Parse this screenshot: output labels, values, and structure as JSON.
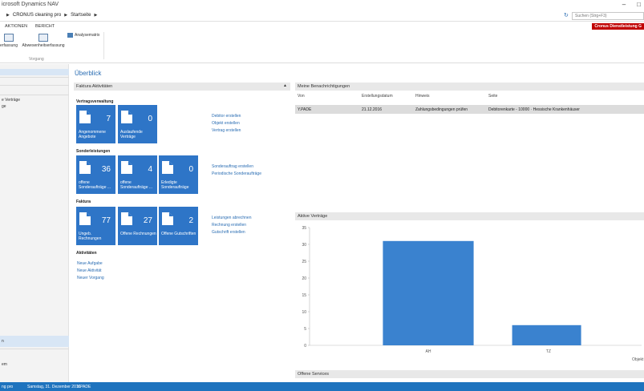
{
  "window": {
    "title": "icrosoft Dynamics NAV"
  },
  "address": {
    "crumbs": [
      "CRONUS cleaning pro",
      "Startseite"
    ],
    "search_placeholder": "Suchen (Strg+F3)"
  },
  "ribbon": {
    "tabs": [
      "AKTIONEN",
      "BERICHT"
    ],
    "company": "Cronus Dienstleistung G",
    "buttons": [
      "erfassung",
      "Abwesenheitserfassung"
    ],
    "analyse": "Analysematrix",
    "group_label": "Vorgang"
  },
  "nav": {
    "items": [
      "e Verträge",
      "ge",
      "n",
      "em"
    ]
  },
  "page": {
    "title": "Überblick"
  },
  "faktura": {
    "header": "Faktura Aktivitäten",
    "sections": {
      "vertrag": "Vertragsverwaltung",
      "sonder": "Sonderleistungen",
      "faktura": "Faktura",
      "aktiv": "Aktivitäten"
    },
    "tiles": {
      "angebote": {
        "value": "7",
        "label": "Angenommene Angebote"
      },
      "vertraege": {
        "value": "0",
        "label": "Auslaufende Verträge"
      },
      "sonder_offen": {
        "value": "36",
        "label": "offene Sonderaufträge ..."
      },
      "sonder_offen2": {
        "value": "4",
        "label": "offene Sonderaufträge ..."
      },
      "sonder_erl": {
        "value": "0",
        "label": "Erledigte Sonderaufträge"
      },
      "ungeb": {
        "value": "77",
        "label": "Ungeb. Rechnungen"
      },
      "rechnungen": {
        "value": "27",
        "label": "Offene Rechnungen"
      },
      "gutschriften": {
        "value": "2",
        "label": "Offene Gutschriften"
      }
    },
    "links": {
      "debitor": "Debitor erstellen",
      "objekt": "Objekt erstellen",
      "vertrag": "Vertrag erstellen",
      "sonderauftrag": "Sonderauftrag erstellen",
      "periodisch": "Periodische Sonderaufträge",
      "leistungen": "Leistungen abrechnen",
      "rechnung": "Rechnung erstellen",
      "gutschrift": "Gutschrift erstellen",
      "aufgabe": "Neue Aufgabe",
      "aktivitaet": "Neue Aktivität",
      "vorgang": "Neuer Vorgang"
    }
  },
  "notifications": {
    "header": "Meine Benachrichtigungen",
    "columns": [
      "Von",
      "Erstellungsdatum",
      "Hinweis",
      "Seite"
    ],
    "rows": [
      {
        "von": "Y.PADE",
        "datum": "21.12.2016",
        "hinweis": "Zahlungsbedingungen prüfen",
        "seite": "Debitorenkarte - 10000 · Hessische Krankenhäuser"
      }
    ]
  },
  "contracts": {
    "header": "Aktive Verträge",
    "axis_fragment": "Objekt"
  },
  "chart_data": {
    "type": "bar",
    "categories": [
      "AH",
      "TZ"
    ],
    "values": [
      31,
      6
    ],
    "ylim": [
      0,
      35
    ],
    "yticks": [
      0,
      5,
      10,
      15,
      20,
      25,
      30,
      35
    ],
    "grid": false,
    "color": "#3a82cf"
  },
  "services": {
    "header": "Offene Services"
  },
  "status": {
    "company": "ng pro",
    "date": "Samstag, 31. Dezember 2016",
    "user": "Y.PADE"
  }
}
